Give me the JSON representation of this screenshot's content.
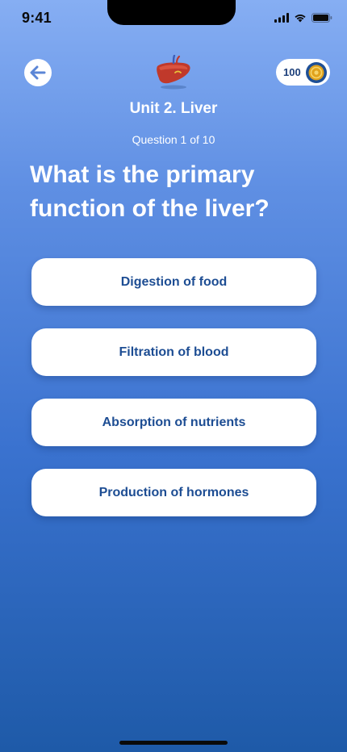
{
  "status_bar": {
    "time": "9:41"
  },
  "header": {
    "unit_title": "Unit 2. Liver",
    "progress": "Question 1 of 10",
    "coins": "100",
    "icons": {
      "back": "arrow-left-icon",
      "unit": "liver-icon",
      "coin": "coin-icon"
    }
  },
  "question": {
    "text": "What is the primary function of the liver?"
  },
  "answers": [
    {
      "label": "Digestion of food"
    },
    {
      "label": "Filtration of blood"
    },
    {
      "label": "Absorption of nutrients"
    },
    {
      "label": "Production of hormones"
    }
  ],
  "colors": {
    "gradient_top": "#86aef3",
    "gradient_bottom": "#1e5aa8",
    "answer_text": "#1d4d93",
    "coin": "#d9a21c"
  }
}
